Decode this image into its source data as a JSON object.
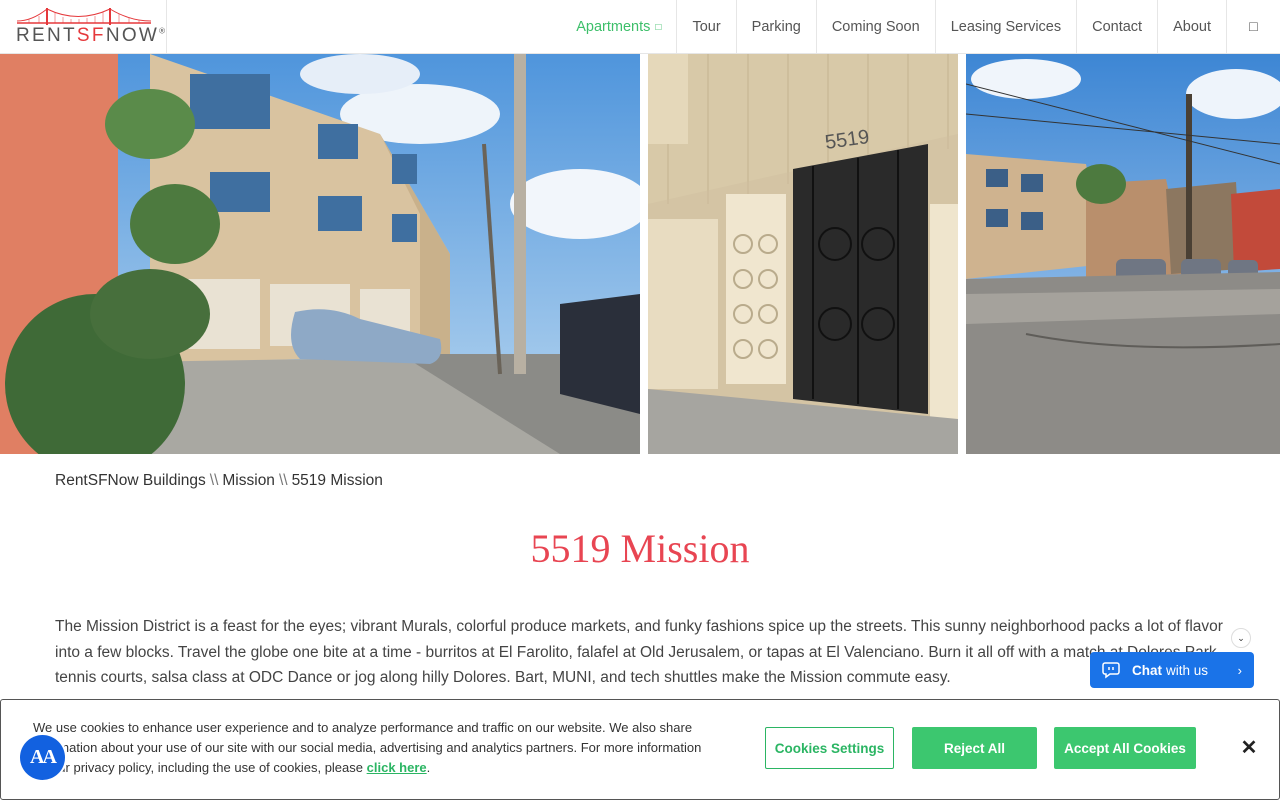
{
  "brand": {
    "logo_prefix": "RENT",
    "logo_accent": "SF",
    "logo_suffix": "NOW",
    "logo_mark": "®",
    "accent_color": "#e5383b"
  },
  "nav": {
    "items": [
      {
        "label": "Apartments",
        "caret": "□"
      },
      {
        "label": "Tour"
      },
      {
        "label": "Parking"
      },
      {
        "label": "Coming Soon"
      },
      {
        "label": "Leasing Services"
      },
      {
        "label": "Contact"
      },
      {
        "label": "About"
      }
    ],
    "search_icon": "□",
    "active_color": "#3dbf6a"
  },
  "gallery": {
    "photos": [
      "building-street-view",
      "building-entrance-5519",
      "street-view-neighborhood"
    ]
  },
  "breadcrumb": {
    "items": [
      "RentSFNow Buildings",
      "Mission",
      "5519 Mission"
    ],
    "separator": "\\\\"
  },
  "page": {
    "title": "5519 Mission",
    "title_color": "#e84552",
    "description": "The Mission District is a feast for the eyes; vibrant Murals, colorful produce markets, and funky fashions spice up the streets. This sunny neighborhood packs a lot of flavor into a few blocks. Travel the globe one bite at a time - burritos at El Farolito, falafel at Old Jerusalem, or tapas at El Valenciano. Burn it all off with a match at Dolores Park tennis courts, salsa class at ODC Dance or jog along hilly Dolores. Bart, MUNI, and tech shuttles make the Mission commute easy."
  },
  "chat": {
    "label_bold": "Chat",
    "label_rest": "with us",
    "collapse_icon": "⌄",
    "chevron": "›",
    "color": "#1a73e8"
  },
  "cookie_banner": {
    "text": "We use cookies to enhance user experience and to analyze performance and traffic on our website. We also share information about your use of our site with our social media, advertising and analytics partners. For more information on our privacy policy, including the use of cookies, please",
    "link_label": "click here",
    "link_suffix": ".",
    "settings_label": "Cookies Settings",
    "reject_label": "Reject All",
    "accept_label": "Accept All Cookies",
    "close_label": "✕",
    "button_color": "#3cc76f"
  },
  "accessibility": {
    "label": "AA"
  }
}
